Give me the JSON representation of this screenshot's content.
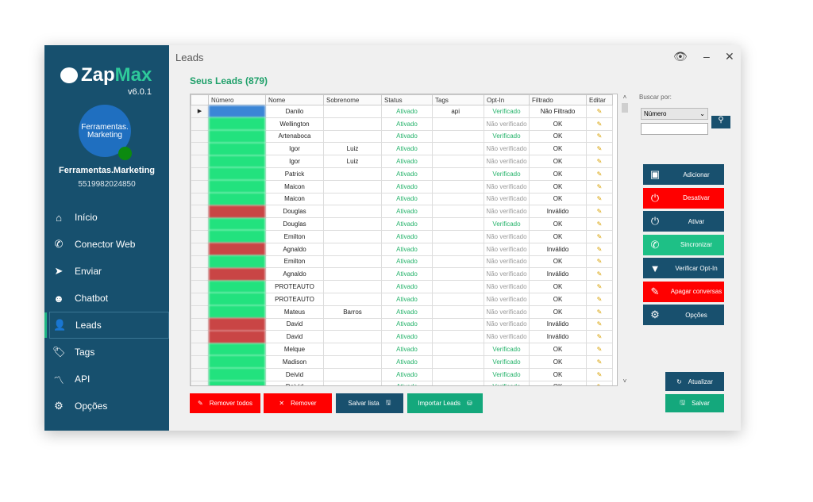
{
  "app": {
    "name_part1": "Zap",
    "name_part2": "Max",
    "version": "v6.0.1",
    "window_title": "Leads"
  },
  "user": {
    "avatar_line1": "Ferramentas.",
    "avatar_line2": "Marketing",
    "name": "Ferramentas.Marketing",
    "phone": "5519982024850"
  },
  "sidebar": {
    "items": [
      {
        "label": "Início",
        "icon": "home-icon",
        "glyph": "⌂"
      },
      {
        "label": "Conector Web",
        "icon": "whatsapp-icon",
        "glyph": "✆"
      },
      {
        "label": "Enviar",
        "icon": "send-icon",
        "glyph": "➤"
      },
      {
        "label": "Chatbot",
        "icon": "robot-icon",
        "glyph": "☻"
      },
      {
        "label": "Leads",
        "icon": "user-icon",
        "glyph": "👤",
        "active": true
      },
      {
        "label": "Tags",
        "icon": "tag-icon",
        "glyph": "🏷"
      },
      {
        "label": "API",
        "icon": "rss-icon",
        "glyph": "〽"
      },
      {
        "label": "Opções",
        "icon": "gear-icon",
        "glyph": "⚙"
      }
    ]
  },
  "main": {
    "subtitle": "Seus Leads (879)",
    "columns": [
      "Número",
      "Nome",
      "Sobrenome",
      "Status",
      "Tags",
      "Opt-In",
      "Filtrado",
      "Editar"
    ],
    "rows": [
      [
        "Danilo",
        "",
        "Ativado",
        "api",
        "Verificado",
        "Não Filtrado"
      ],
      [
        "Wellington",
        "",
        "Ativado",
        "",
        "Não verificado",
        "OK"
      ],
      [
        "Artenaboca",
        "",
        "Ativado",
        "",
        "Verificado",
        "OK"
      ],
      [
        "Igor",
        "Luiz",
        "Ativado",
        "",
        "Não verificado",
        "OK"
      ],
      [
        "Igor",
        "Luiz",
        "Ativado",
        "",
        "Não verificado",
        "OK"
      ],
      [
        "Patrick",
        "",
        "Ativado",
        "",
        "Verificado",
        "OK"
      ],
      [
        "Maicon",
        "",
        "Ativado",
        "",
        "Não verificado",
        "OK"
      ],
      [
        "Maicon",
        "",
        "Ativado",
        "",
        "Não verificado",
        "OK"
      ],
      [
        "Douglas",
        "",
        "Ativado",
        "",
        "Não verificado",
        "Inválido"
      ],
      [
        "Douglas",
        "",
        "Ativado",
        "",
        "Verificado",
        "OK"
      ],
      [
        "Emilton",
        "",
        "Ativado",
        "",
        "Não verificado",
        "OK"
      ],
      [
        "Agnaldo",
        "",
        "Ativado",
        "",
        "Não verificado",
        "Inválido"
      ],
      [
        "Emilton",
        "",
        "Ativado",
        "",
        "Não verificado",
        "OK"
      ],
      [
        "Agnaldo",
        "",
        "Ativado",
        "",
        "Não verificado",
        "Inválido"
      ],
      [
        "PROTEAUTO",
        "",
        "Ativado",
        "",
        "Não verificado",
        "OK"
      ],
      [
        "PROTEAUTO",
        "",
        "Ativado",
        "",
        "Não verificado",
        "OK"
      ],
      [
        "Mateus",
        "Barros",
        "Ativado",
        "",
        "Não verificado",
        "OK"
      ],
      [
        "David",
        "",
        "Ativado",
        "",
        "Não verificado",
        "Inválido"
      ],
      [
        "David",
        "",
        "Ativado",
        "",
        "Não verificado",
        "Inválido"
      ],
      [
        "Melque",
        "",
        "Ativado",
        "",
        "Verificado",
        "OK"
      ],
      [
        "Madison",
        "",
        "Ativado",
        "",
        "Verificado",
        "OK"
      ],
      [
        "Deivid",
        "",
        "Ativado",
        "",
        "Verificado",
        "OK"
      ],
      [
        "Deivid",
        "",
        "Ativado",
        "",
        "Verificado",
        "OK"
      ]
    ]
  },
  "search": {
    "label": "Buscar por:",
    "selected": "Número",
    "value": ""
  },
  "actions": [
    {
      "label": "Adicionar",
      "icon": "contact-card-icon",
      "glyph": "▣",
      "color": "blue"
    },
    {
      "label": "Desativar",
      "icon": "power-icon",
      "glyph": "⏻",
      "color": "red"
    },
    {
      "label": "Ativar",
      "icon": "power-on-icon",
      "glyph": "⏻",
      "color": "blue"
    },
    {
      "label": "Sincronizar",
      "icon": "whatsapp-icon",
      "glyph": "✆",
      "color": "grn2"
    },
    {
      "label": "Verificar Opt-In",
      "icon": "filter-icon",
      "glyph": "▼",
      "color": "blue"
    },
    {
      "label": "Apagar conversas",
      "icon": "eraser-icon",
      "glyph": "✎",
      "color": "red"
    },
    {
      "label": "Opções",
      "icon": "gear-icon",
      "glyph": "⚙",
      "color": "blue"
    }
  ],
  "footer": {
    "remove_all": "Remover todos",
    "remove": "Remover",
    "save_list": "Salvar lista",
    "import": "Importar Leads",
    "refresh": "Atualizar",
    "save": "Salvar"
  },
  "colors": {
    "sidebar": "#17506e",
    "accent": "#1fb584",
    "danger": "#ff0000"
  }
}
